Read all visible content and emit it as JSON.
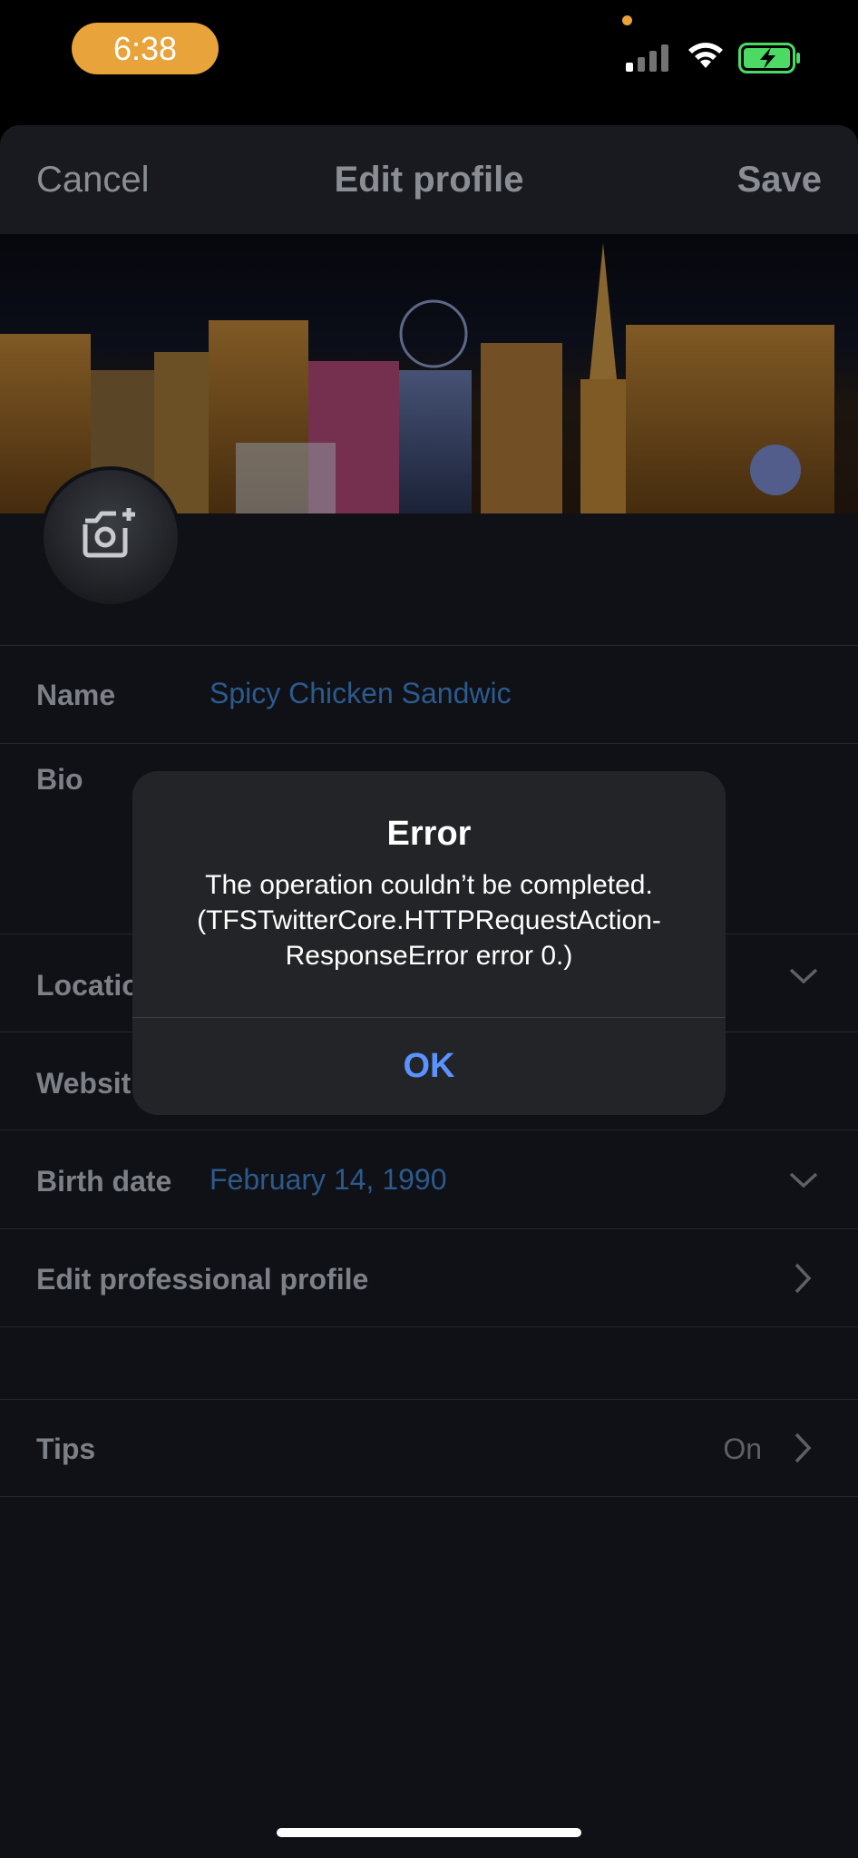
{
  "status_bar": {
    "time": "6:38",
    "signal_icon": "cellular-signal-icon",
    "wifi_icon": "wifi-icon",
    "battery_icon": "battery-charging-icon"
  },
  "nav": {
    "cancel_label": "Cancel",
    "title": "Edit profile",
    "save_label": "Save"
  },
  "profile": {
    "header_image": "city-skyline-night-photo",
    "avatar_icon": "camera-add-icon"
  },
  "fields": {
    "name": {
      "label": "Name",
      "value": "Spicy Chicken Sandwic"
    },
    "bio": {
      "label": "Bio"
    },
    "location": {
      "label": "Locatio"
    },
    "website": {
      "label": "Websit"
    },
    "birth_date": {
      "label": "Birth date",
      "value": "February 14, 1990"
    },
    "professional": {
      "label": "Edit professional profile"
    },
    "tips": {
      "label": "Tips",
      "value": "On"
    }
  },
  "dialog": {
    "title": "Error",
    "message": "The operation couldn’t be completed.\n(TFSTwitterCore.HTTPRequestAction-\nResponseError error 0.)",
    "ok_label": "OK"
  },
  "colors": {
    "accent_link": "#5a93ff",
    "field_value": "#2c5a8c",
    "time_pill": "#e8a33a",
    "battery_charging": "#4cd964"
  }
}
